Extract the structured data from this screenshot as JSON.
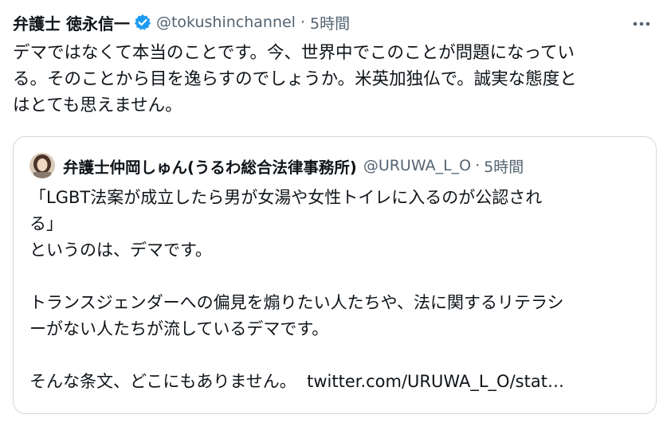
{
  "tweet": {
    "display_name": "弁護士 徳永信一",
    "handle": "@tokushinchannel",
    "separator": "·",
    "time": "5時間",
    "more_icon": "more-horizontal-icon",
    "verified_icon": "verified-badge-icon",
    "verified_color": "#1d9bf0",
    "lines": [
      "デマではなくて本当のことです。今、世界中でこのことが問題になってい",
      "る。そのことから目を逸らすのでしょうか。米英加独仏で。誠実な態度と",
      "はとても思えません。"
    ]
  },
  "quote": {
    "display_name": "弁護士仲岡しゅん(うるわ総合法律事務所)",
    "handle": "@URUWA_L_O",
    "separator": "·",
    "time": "5時間",
    "avatar_icon": "profile-avatar",
    "lines": [
      "「LGBT法案が成立したら男が女湯や女性トイレに入るのが公認され",
      "る」",
      "というのは、デマです。",
      "",
      "トランスジェンダーへの偏見を煽りたい人たちや、法に関するリテラシ",
      "ーがない人たちが流しているデマです。",
      "",
      "そんな条文、どこにもありません。"
    ],
    "link": "twitter.com/URUWA_L_O/stat…"
  }
}
